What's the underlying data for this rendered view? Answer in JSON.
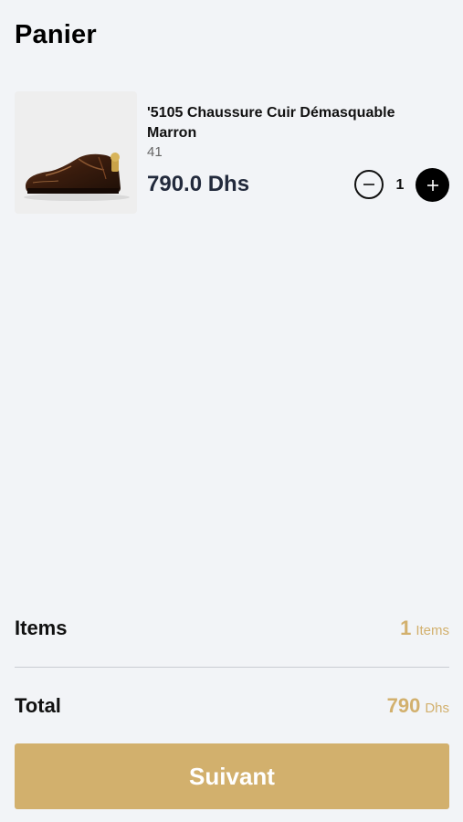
{
  "header": {
    "title": "Panier"
  },
  "cart": {
    "items": [
      {
        "name": "'5105 Chaussure Cuir Démasquable Marron",
        "size": "41",
        "price": "790.0 Dhs",
        "quantity": "1",
        "image_icon": "brown-leather-shoe-image"
      }
    ]
  },
  "summary": {
    "items_label": "Items",
    "items_count": "1",
    "items_unit": "Items",
    "total_label": "Total",
    "total_value": "790",
    "total_unit": "Dhs"
  },
  "actions": {
    "next_label": "Suivant"
  },
  "colors": {
    "accent": "#d2b06d",
    "background": "#f2f4f7",
    "price_text": "#222a3c"
  }
}
